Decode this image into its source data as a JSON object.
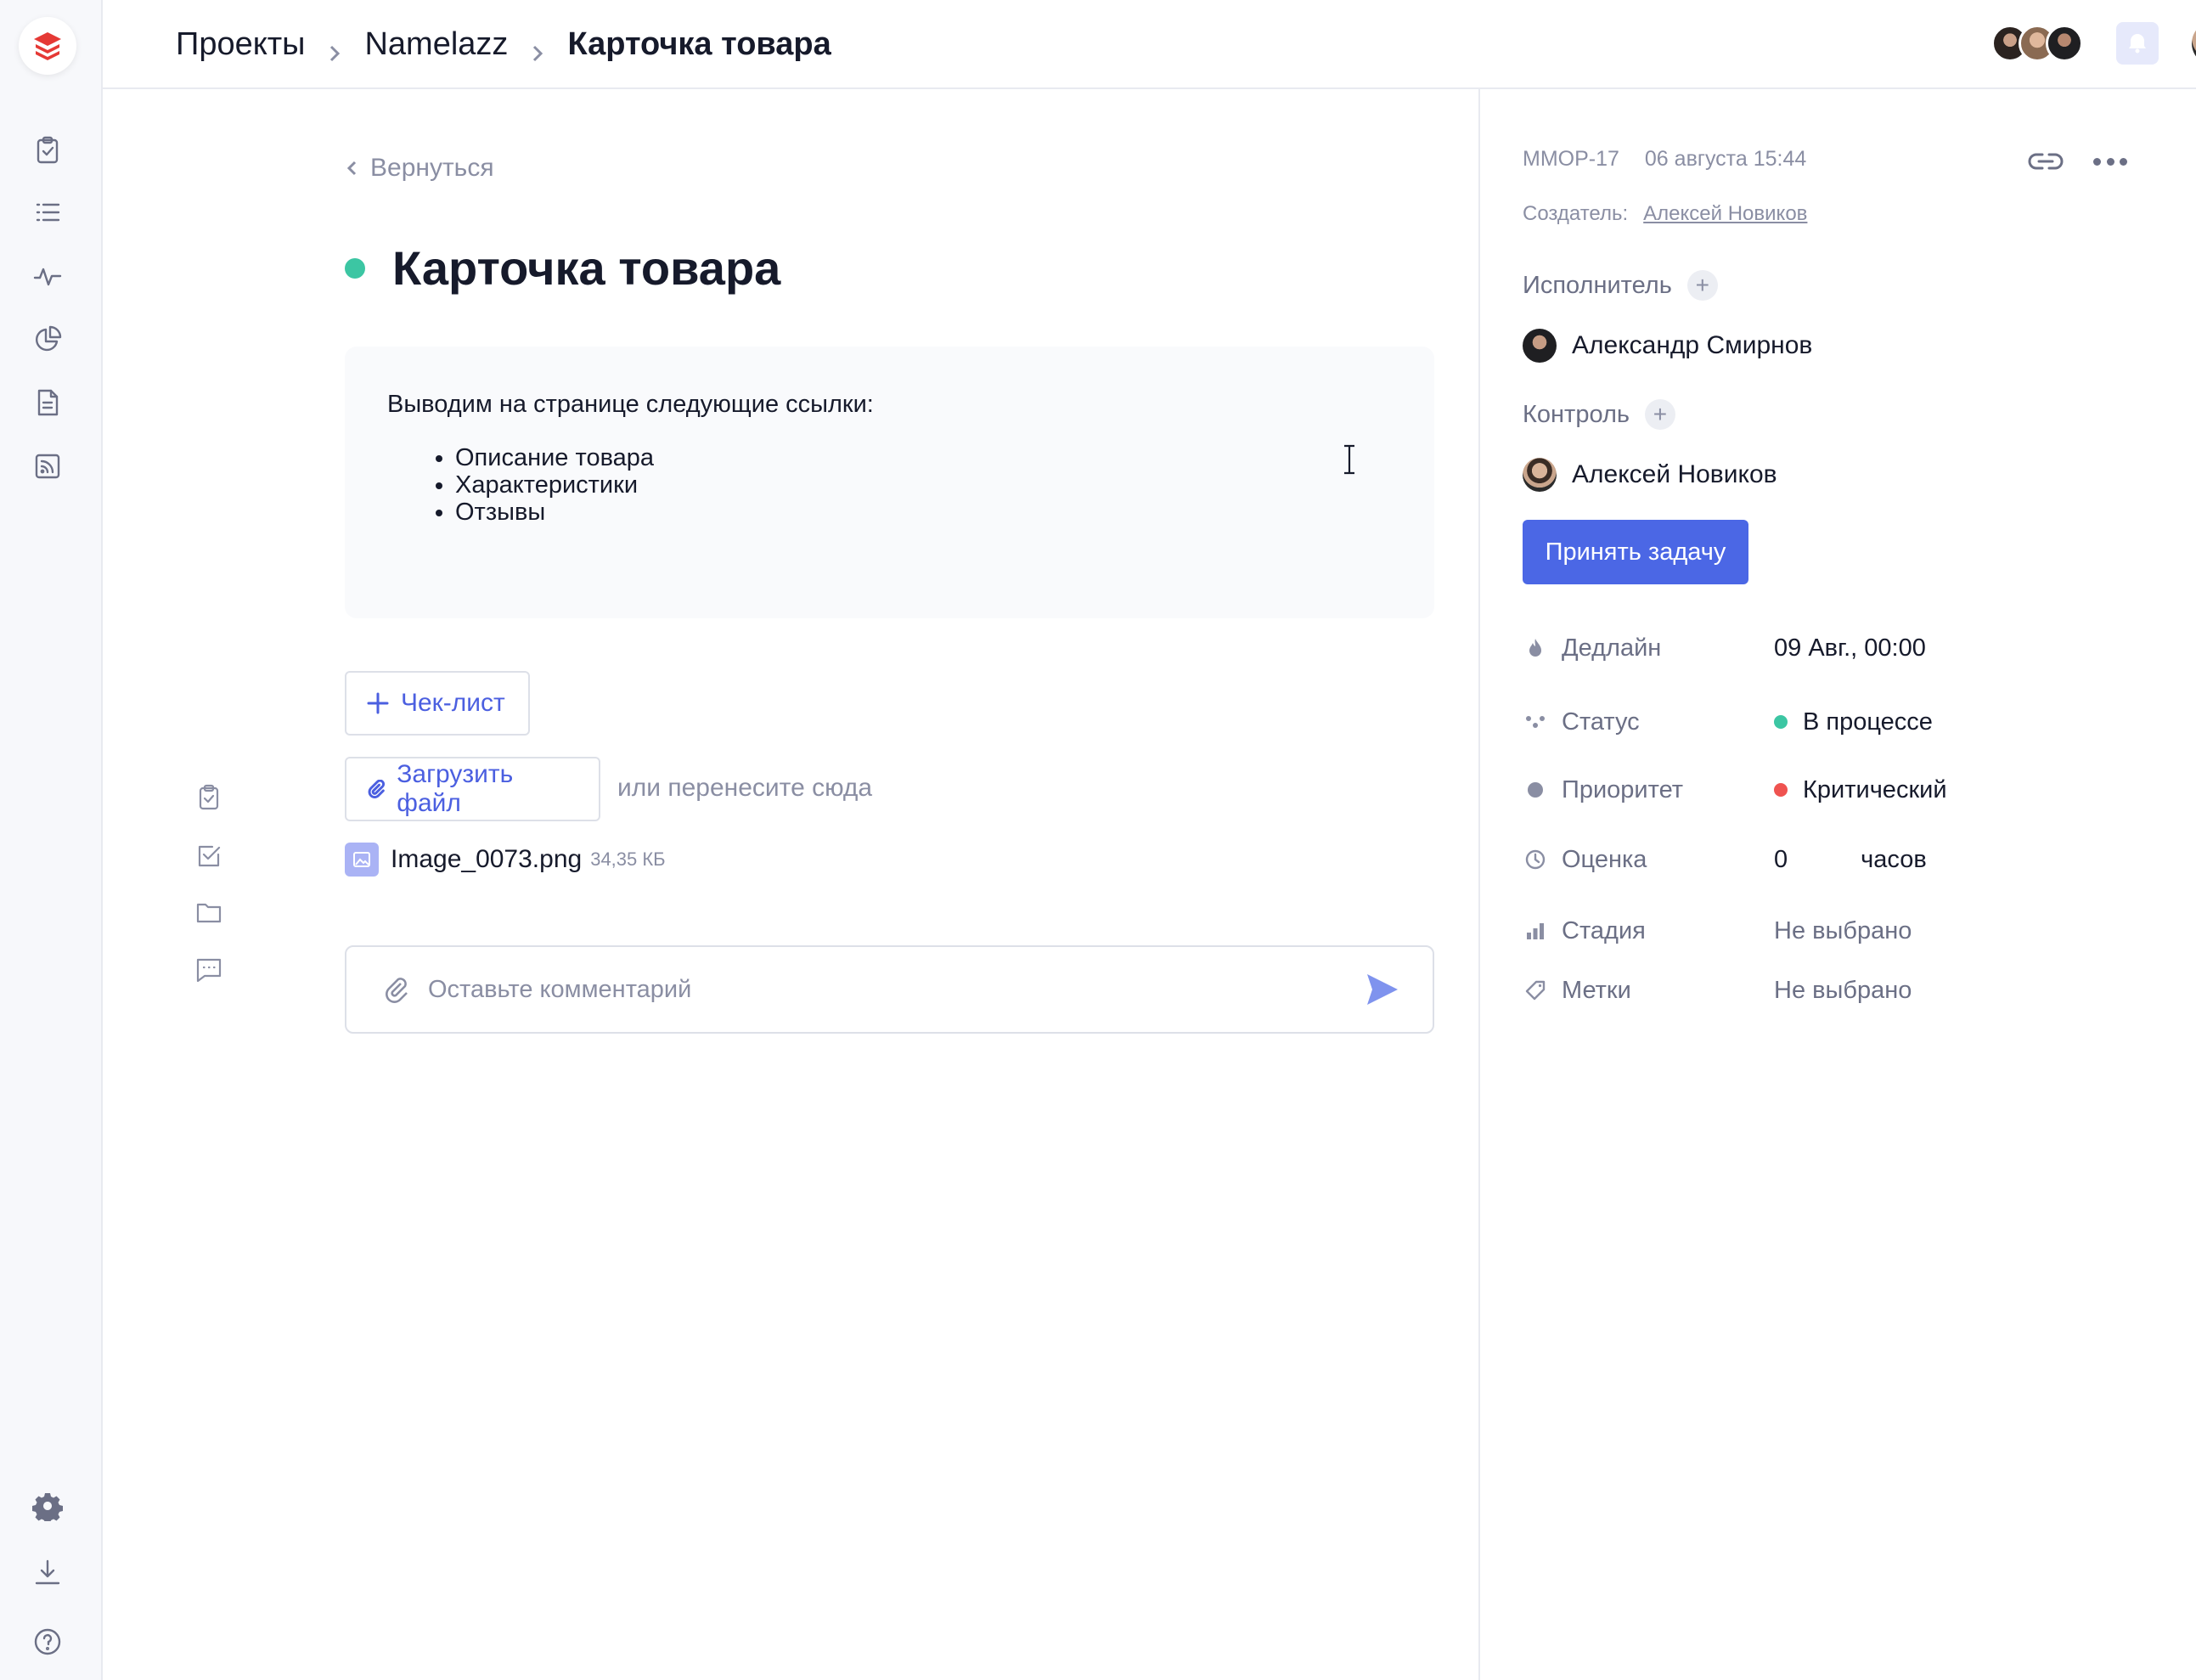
{
  "breadcrumb": {
    "items": [
      "Проекты",
      "Namelazz"
    ],
    "current": "Карточка товара"
  },
  "colors": {
    "accent": "#4b67e5",
    "status_in_progress": "#3cc6a3",
    "priority_critical": "#ef5350",
    "logo": "#e53935"
  },
  "sidebar": {
    "icons": [
      "clipboard-icon",
      "list-icon",
      "activity-icon",
      "pie-chart-icon",
      "document-icon",
      "feed-icon"
    ],
    "bottom_icons": [
      "gear-icon",
      "download-icon",
      "help-icon"
    ]
  },
  "main": {
    "back_label": "Вернуться",
    "title": "Карточка товара",
    "description": {
      "intro": "Выводим на странице следующие ссылки:",
      "items": [
        "Описание товара",
        "Характеристики",
        "Отзывы"
      ]
    },
    "checklist_label": "Чек-лист",
    "upload_label": "Загрузить файл",
    "drop_hint": "или перенесите сюда",
    "file": {
      "name": "Image_0073.png",
      "size": "34,35 КБ"
    },
    "comment_placeholder": "Оставьте комментарий"
  },
  "panel": {
    "task_id": "MMOP-17",
    "date": "06 августа 15:44",
    "creator_label": "Создатель:",
    "creator_name": "Алексей Новиков",
    "assignee_label": "Исполнитель",
    "assignee_name": "Александр Смирнов",
    "control_label": "Контроль",
    "control_name": "Алексей Новиков",
    "accept_label": "Принять задачу",
    "props": {
      "deadline_label": "Дедлайн",
      "deadline_value": "09 Авг., 00:00",
      "status_label": "Статус",
      "status_value": "В процессе",
      "priority_label": "Приоритет",
      "priority_value": "Критический",
      "estimate_label": "Оценка",
      "estimate_value": "0",
      "estimate_unit": "часов",
      "stage_label": "Стадия",
      "stage_value": "Не выбрано",
      "tags_label": "Метки",
      "tags_value": "Не выбрано"
    }
  }
}
